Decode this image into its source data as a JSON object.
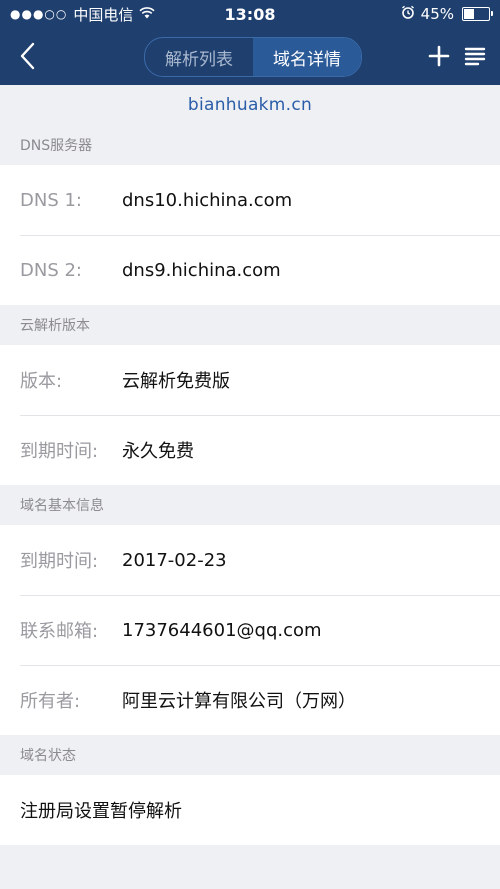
{
  "status_bar": {
    "signal": "●●●○○",
    "carrier": "中国电信",
    "time": "13:08",
    "battery_percent": "45%",
    "battery_level": 0.45
  },
  "nav": {
    "tabs": [
      {
        "label": "解析列表",
        "active": false
      },
      {
        "label": "域名详情",
        "active": true
      }
    ]
  },
  "domain": "bianhuakm.cn",
  "sections": {
    "dns": {
      "title": "DNS服务器",
      "rows": [
        {
          "label": "DNS 1:",
          "value": "dns10.hichina.com"
        },
        {
          "label": "DNS 2:",
          "value": "dns9.hichina.com"
        }
      ]
    },
    "version": {
      "title": "云解析版本",
      "rows": [
        {
          "label": "版本:",
          "value": "云解析免费版"
        },
        {
          "label": "到期时间:",
          "value": "永久免费"
        }
      ]
    },
    "basic": {
      "title": "域名基本信息",
      "rows": [
        {
          "label": "到期时间:",
          "value": "2017-02-23"
        },
        {
          "label": "联系邮箱:",
          "value": "1737644601@qq.com"
        },
        {
          "label": "所有者:",
          "value": "阿里云计算有限公司（万网）"
        }
      ]
    },
    "status": {
      "title": "域名状态",
      "value": "注册局设置暂停解析"
    }
  },
  "colors": {
    "nav_bg": "#1f3f6f",
    "segment_active": "#2b5a99",
    "domain_text": "#2a5da8",
    "page_bg": "#eff0f4"
  },
  "icons": [
    "back-chevron-icon",
    "wifi-icon",
    "alarm-icon",
    "battery-icon",
    "plus-icon",
    "list-menu-icon"
  ]
}
